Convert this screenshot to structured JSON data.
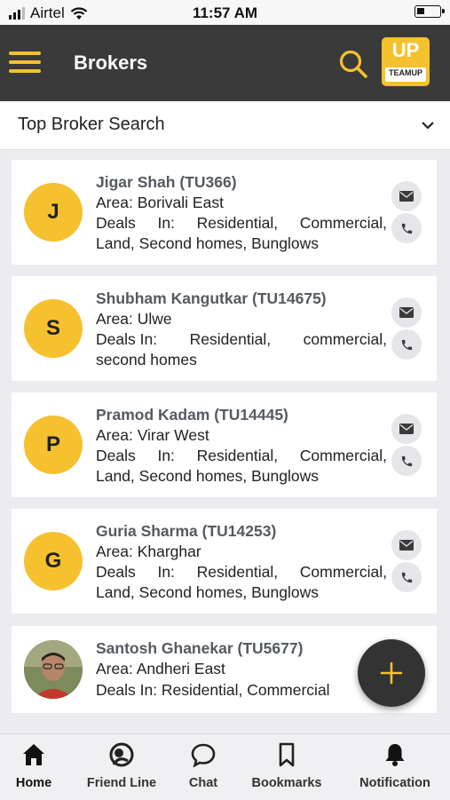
{
  "status_bar": {
    "carrier": "Airtel",
    "time": "11:57 AM"
  },
  "app_bar": {
    "title": "Brokers",
    "logo_text": "UP",
    "logo_subtext": "TEAMUP"
  },
  "filter": {
    "selected": "Top Broker Search"
  },
  "brokers": [
    {
      "initial": "J",
      "name": "Jigar Shah (TU366)",
      "area": "Area: Borivali East",
      "deals_line1": [
        "Deals",
        "In:",
        "Residential,",
        "Commercial,"
      ],
      "deals_line2": "Land, Second homes, Bunglows"
    },
    {
      "initial": "S",
      "name": "Shubham Kangutkar (TU14675)",
      "area": "Area: Ulwe",
      "deals_line1": [
        "Deals In:",
        "Residential,",
        "commercial,"
      ],
      "deals_line2": "second homes"
    },
    {
      "initial": "P",
      "name": "Pramod Kadam (TU14445)",
      "area": "Area: Virar West",
      "deals_line1": [
        "Deals",
        "In:",
        "Residential,",
        "Commercial,"
      ],
      "deals_line2": "Land, Second homes, Bunglows"
    },
    {
      "initial": "G",
      "name": "Guria Sharma (TU14253)",
      "area": "Area: Kharghar",
      "deals_line1": [
        "Deals",
        "In:",
        "Residential,",
        "Commercial,"
      ],
      "deals_line2": "Land, Second homes, Bunglows"
    },
    {
      "initial": "",
      "name": "Santosh Ghanekar (TU5677)",
      "area": "Area: Andheri East",
      "deals_line1": [
        "Deals In: Residential, Commercial"
      ],
      "deals_line2": ""
    }
  ],
  "bottom_nav": [
    {
      "label": "Home",
      "icon": "home-icon",
      "active": true
    },
    {
      "label": "Friend Line",
      "icon": "friend-line-icon",
      "active": false
    },
    {
      "label": "Chat",
      "icon": "chat-icon",
      "active": false
    },
    {
      "label": "Bookmarks",
      "icon": "bookmark-icon",
      "active": false
    },
    {
      "label": "Notification",
      "icon": "bell-icon",
      "active": false
    }
  ],
  "colors": {
    "accent": "#f6c12f",
    "app_bar": "#3a3a3a",
    "background": "#ececf0"
  }
}
